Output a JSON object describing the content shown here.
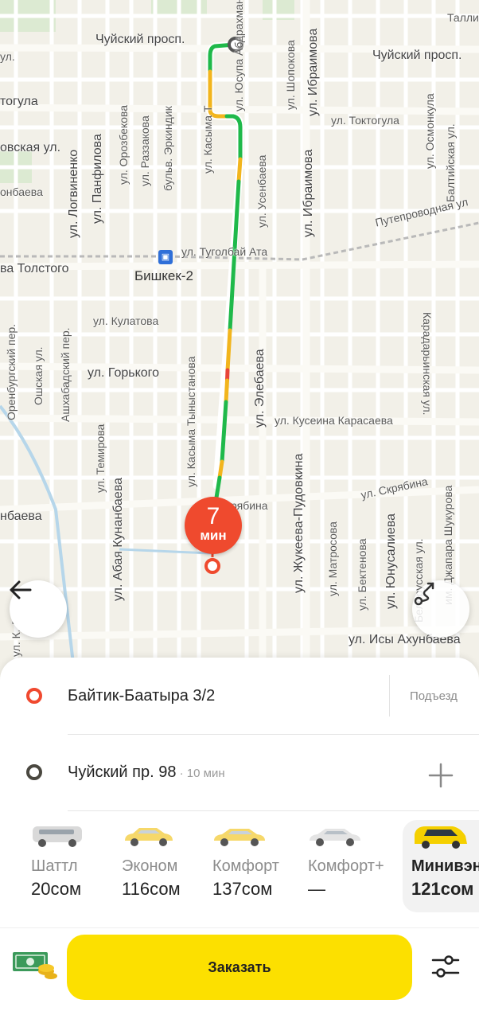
{
  "map": {
    "streets": {
      "chuisky_left": "Чуйский просп.",
      "chuisky_right": "Чуйский просп.",
      "toktogula_left": "тогула",
      "toktogula_right": "ул. Токтогула",
      "ovskaya": "овская ул.",
      "konbaeva": "онбаева",
      "tolstogo": "ва Толстого",
      "tugolbay": "ул. Туголбай Ата",
      "puteprovodnaya": "Путепроводная ул",
      "kulatova": "ул. Кулатова",
      "gorkogo": "ул. Горького",
      "karasaeva": "ул. Кусеина Карасаева",
      "skryabina_left": "рябина",
      "skryabina_right": "ул. Скрябина",
      "anbaeva": "нбаева",
      "akhunbaeva": "ул. Исы Ахунбаева",
      "yusupa": "ул. Юсупа Абдрахманова",
      "shopokova": "ул. Шопокова",
      "ibraimova_top": "ул. Ибраимова",
      "ibraimova_mid": "ул. Ибраимова",
      "osmonkula": "ул. Осмонкула",
      "baltiyskaya": "Балтийская ул.",
      "logvinenko": "ул. Логвиненко",
      "panfilova": "ул. Панфилова",
      "orozbekova": "ул. Орозбекова",
      "razzakova": "ул. Раззакова",
      "erkindik": "бульв. Эркиндик",
      "kasyma_top": "ул. Касыма Т",
      "useinbaeva": "ул. Усенбаева",
      "orenburgsky": "Оренбургский пер.",
      "oshskaya": "Ошская ул.",
      "ashkhabadsky": "Ашхабадский пер.",
      "elebaeva": "ул. Элебаева",
      "karadaryinskaya": "Карадарьинская ул.",
      "temirova": "ул. Темирова",
      "kasyma_tynystanova": "ул. Касыма Тыныстанова",
      "kunanbaeva": "ул. Абая Кунанбаева",
      "zhukeeva": "ул. Жукеева-Пудовкина",
      "matrosova": "ул. Матросова",
      "bektenova": "ул. Бектенова",
      "yunusalieva": "ул. Юнусалиева",
      "belorusskaya": "Белорусская ул.",
      "shukurova": "им. Джапара Шукурова",
      "tallin": "Таллин",
      "ul_left": "ул.",
      "kl": "ул. К. Л"
    },
    "station": "Бишкек-2",
    "eta": {
      "value": "7",
      "unit": "мин"
    },
    "route_colors": {
      "free": "#1fb94a",
      "slow": "#f2b51d",
      "jam": "#e8443a"
    }
  },
  "buttons": {
    "back": "arrow-left-icon",
    "route": "route-icon"
  },
  "trip": {
    "from": {
      "address": "Байтик-Баатыра 3/2",
      "entrance": "Подъезд",
      "dot_color": "#f0492f"
    },
    "to": {
      "address": "Чуйский пр. 98",
      "duration": " · 10 мин",
      "dot_color": "#4a4840"
    }
  },
  "tariffs": [
    {
      "name": "Шаттл",
      "price": "20сом",
      "car_color": "#d8d8d8"
    },
    {
      "name": "Эконом",
      "price": "116сом",
      "car_color": "#f6d86a"
    },
    {
      "name": "Комфорт",
      "price": "137сом",
      "car_color": "#f6d86a"
    },
    {
      "name": "Комфорт+",
      "price": "—",
      "car_color": "#e4e4e4"
    },
    {
      "name": "Минивэн",
      "price": "121сом",
      "car_color": "#f5d000",
      "selected": true
    }
  ],
  "order": {
    "label": "Заказать"
  },
  "payment": {
    "icon": "cash-icon"
  },
  "settings": {
    "icon": "settings-sliders-icon"
  }
}
